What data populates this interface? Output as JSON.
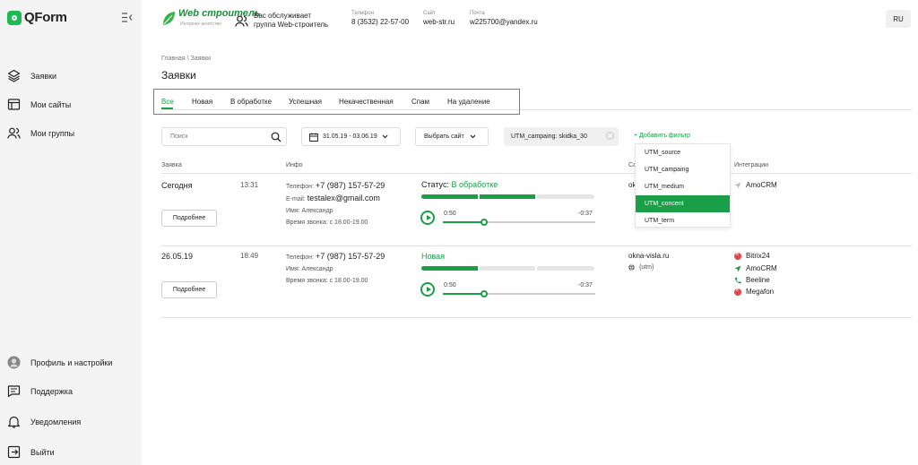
{
  "app": {
    "logo_text": "QForm"
  },
  "sidebar": {
    "items": [
      {
        "label": "Заявки"
      },
      {
        "label": "Мои сайты"
      },
      {
        "label": "Мои группы"
      }
    ],
    "bottom": [
      {
        "label": "Профиль и настройки"
      },
      {
        "label": "Поддержка"
      },
      {
        "label": "Уведомления"
      },
      {
        "label": "Выйти"
      }
    ]
  },
  "header": {
    "brand_name": "Web строитель",
    "brand_tagline": "Интернет-агентство",
    "served_line1": "Вас обслуживает",
    "served_line2": "группа Web-строитель",
    "phone_label": "Телефон",
    "phone_value": "8 (3532) 22-57-00",
    "site_label": "Сайт",
    "site_value": "web-str.ru",
    "mail_label": "Почта",
    "mail_value": "w225700@yandex.ru",
    "lang": "RU"
  },
  "page": {
    "breadcrumb": "Главная \\ Заявки",
    "title": "Заявки"
  },
  "tabs": [
    {
      "label": "Все",
      "active": true
    },
    {
      "label": "Новая"
    },
    {
      "label": "В обработке"
    },
    {
      "label": "Успешная"
    },
    {
      "label": "Некачественная"
    },
    {
      "label": "Спам"
    },
    {
      "label": "На удаление"
    }
  ],
  "filters": {
    "search_placeholder": "Поиск",
    "date_range": "31.05.19 - 03.06.19",
    "site_select": "Выбрать сайт",
    "chip_key": "UTM_campaing:",
    "chip_value": "skidka_30",
    "add_filter": "+ Добавить фильтр",
    "dropdown": [
      "UTM_source",
      "UTM_campaing",
      "UTM_medium",
      "UTM_concent",
      "UTM_term"
    ],
    "dropdown_selected_index": 3
  },
  "columns": {
    "request": "Заявка",
    "info": "Инфо",
    "site": "Са",
    "integrations": "Интеграции"
  },
  "rows": [
    {
      "date": "Сегодня",
      "time": "13:31",
      "phone_label": "Телефон:",
      "phone": "+7 (987) 157-57-29",
      "email_label": "E-mail:",
      "email": "testalex@gmail.com",
      "name": "Имя: Александр",
      "callback": "Время звонка: с 18.00-19.00",
      "more": "Подробнее",
      "status_prefix": "Статус:",
      "status": "В обработке",
      "progress": 0.67,
      "audio_start": "0:50",
      "audio_end": "-0:37",
      "audio_played": 0.27,
      "site": "ok",
      "site_sub": "",
      "integrations": [
        {
          "name": "AmoCRM",
          "icon": "send-icon"
        }
      ]
    },
    {
      "date": "26.05.19",
      "time": "18:49",
      "phone_label": "Телефон:",
      "phone": "+7 (987) 157-57-29",
      "name": "Имя: Александр",
      "callback": "Время звонка: с 18.00-19.00",
      "more": "Подробнее",
      "status": "Новая",
      "progress": 0.33,
      "audio_start": "0:50",
      "audio_end": "-0:37",
      "audio_played": 0.27,
      "site": "okna-visla.ru",
      "site_sub": "{utm}",
      "integrations": [
        {
          "name": "Bitrix24",
          "icon": "error-icon"
        },
        {
          "name": "AmoCRM",
          "icon": "send-icon"
        },
        {
          "name": "Beeline",
          "icon": "phone-icon"
        },
        {
          "name": "Megafon",
          "icon": "error-icon"
        }
      ]
    }
  ],
  "colors": {
    "accent": "#1a9e47",
    "highlight_box": "#e05050",
    "error": "#e04545"
  }
}
